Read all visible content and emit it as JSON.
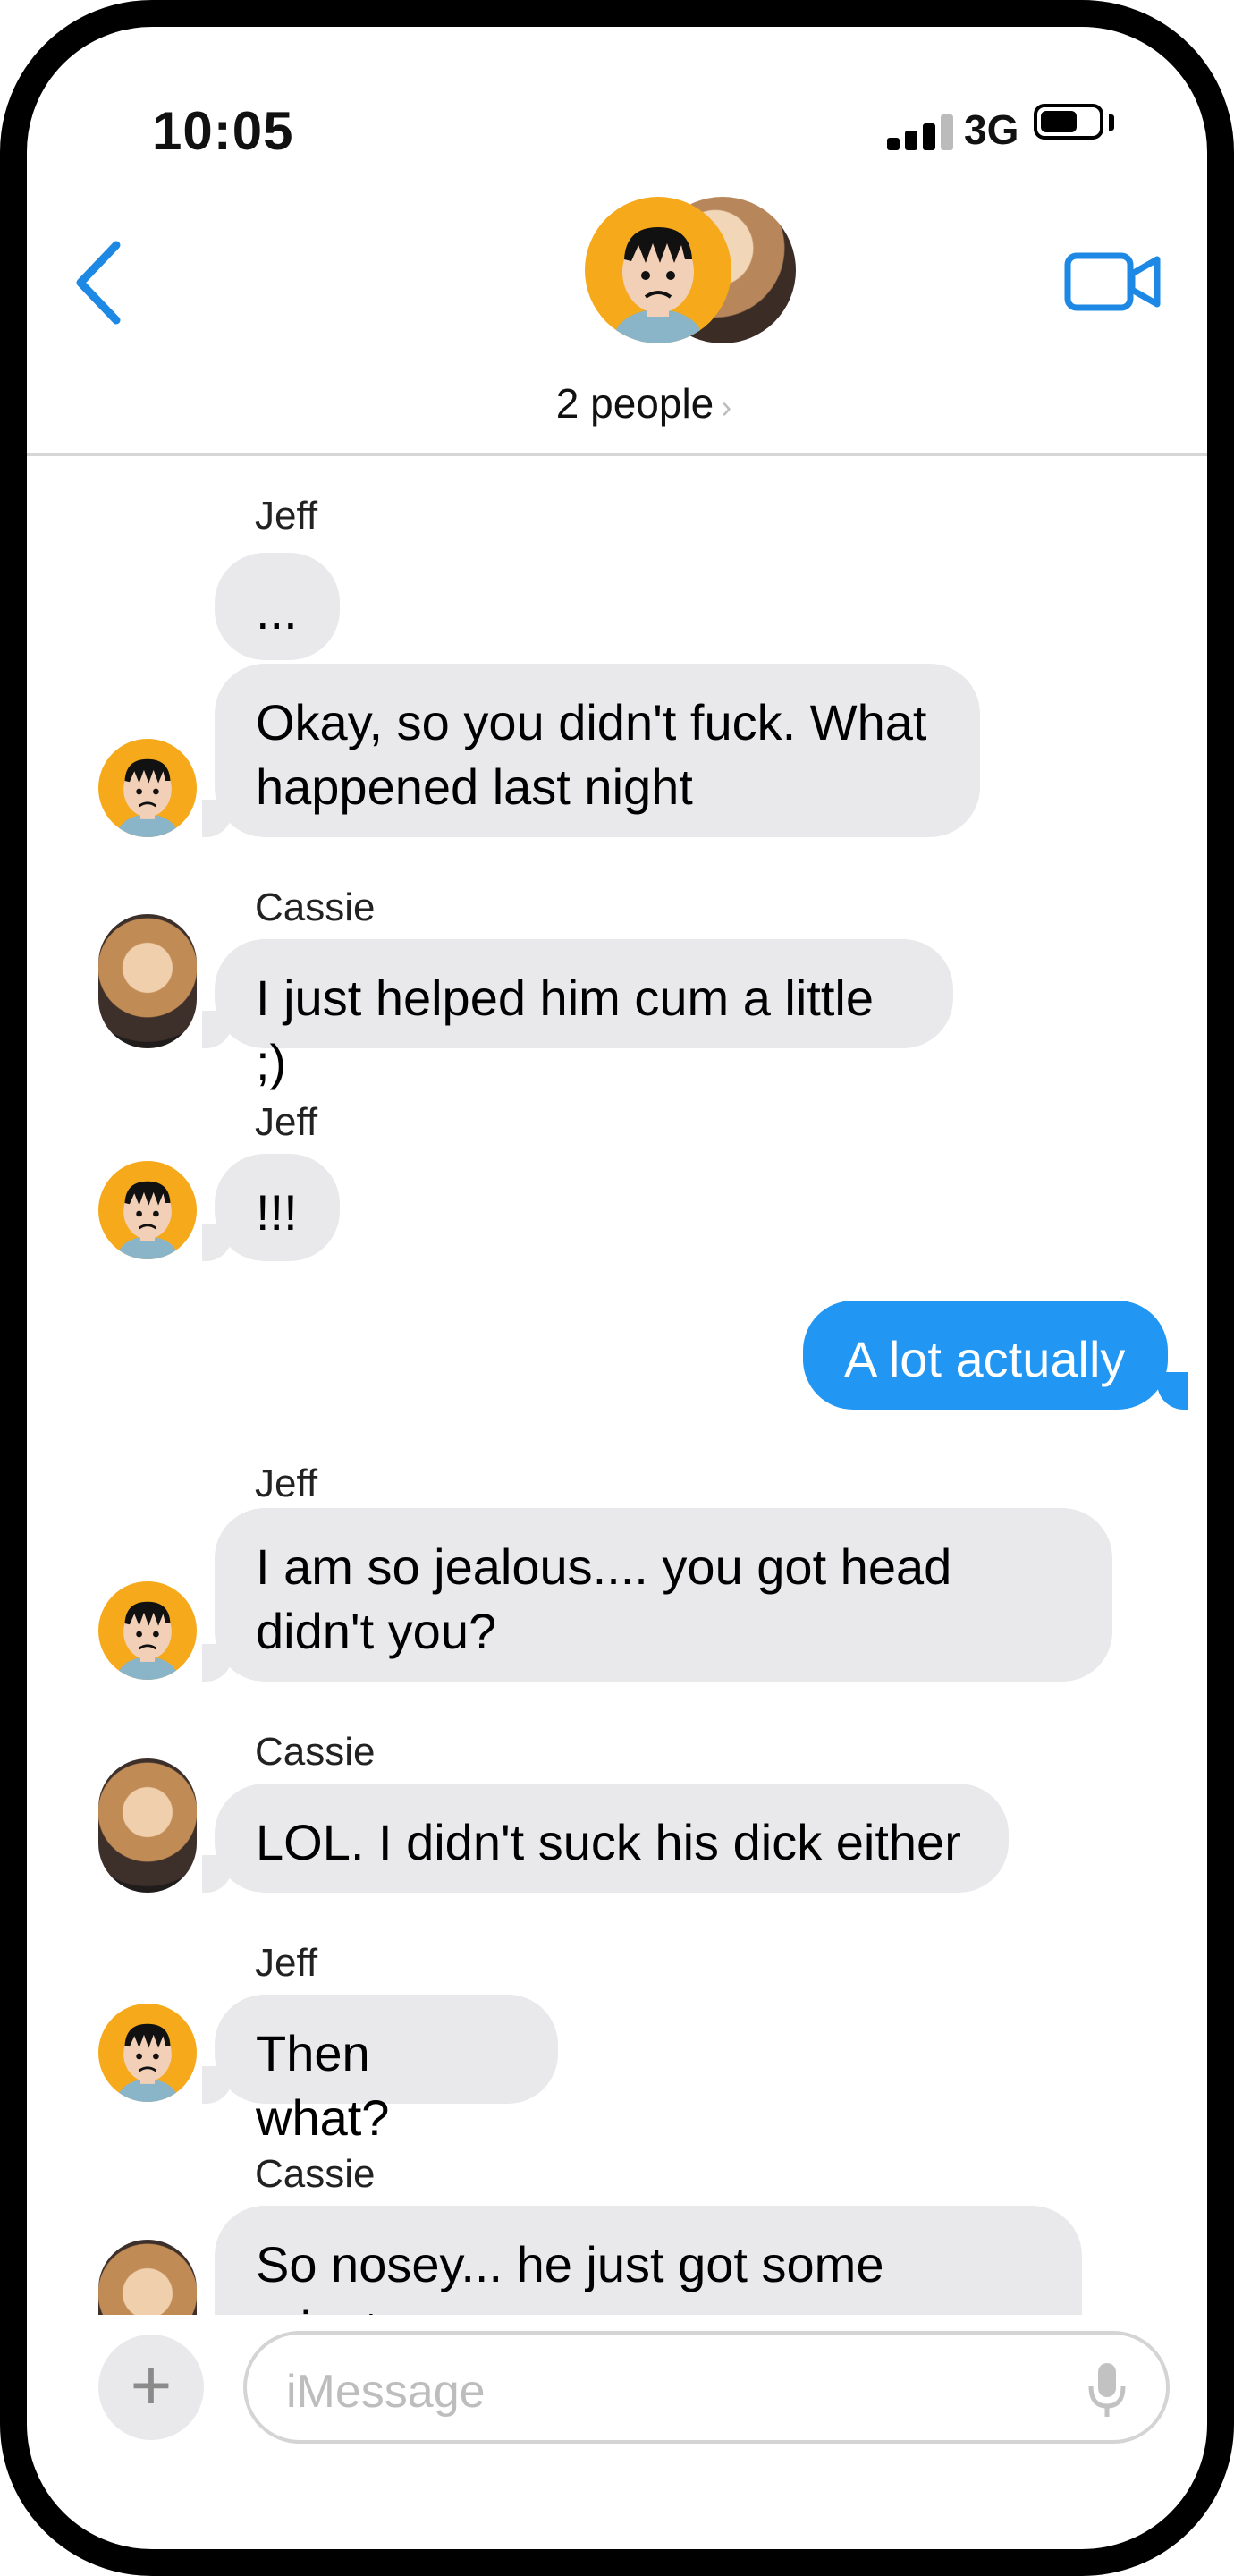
{
  "status_bar": {
    "time": "10:05",
    "network": "3G"
  },
  "header": {
    "subtitle": "2 people",
    "chevron": "›"
  },
  "messages": [
    {
      "sender": "Jeff",
      "text": "...",
      "direction": "incoming"
    },
    {
      "sender": "Jeff",
      "text": "Okay, so you didn't fuck.  What happened last night",
      "direction": "incoming"
    },
    {
      "sender": "Cassie",
      "text": "I just helped him cum a little ;)",
      "direction": "incoming"
    },
    {
      "sender": "Jeff",
      "text": "!!!",
      "direction": "incoming"
    },
    {
      "sender": "",
      "text": "A lot actually",
      "direction": "outgoing"
    },
    {
      "sender": "Jeff",
      "text": "I am so jealous.... you got head didn't you?",
      "direction": "incoming"
    },
    {
      "sender": "Cassie",
      "text": "LOL.  I didn't suck his dick either",
      "direction": "incoming"
    },
    {
      "sender": "Jeff",
      "text": "Then what?",
      "direction": "incoming"
    },
    {
      "sender": "Cassie",
      "text": "So nosey... he just got some private",
      "direction": "incoming"
    }
  ],
  "input": {
    "placeholder": "iMessage",
    "plus": "+"
  },
  "colors": {
    "accent": "#2196f3",
    "incoming_bubble": "#e9e9eb",
    "jeff_avatar": "#f5a91b"
  },
  "icons": [
    "back-chevron-icon",
    "video-camera-icon",
    "plus-icon",
    "microphone-icon"
  ]
}
